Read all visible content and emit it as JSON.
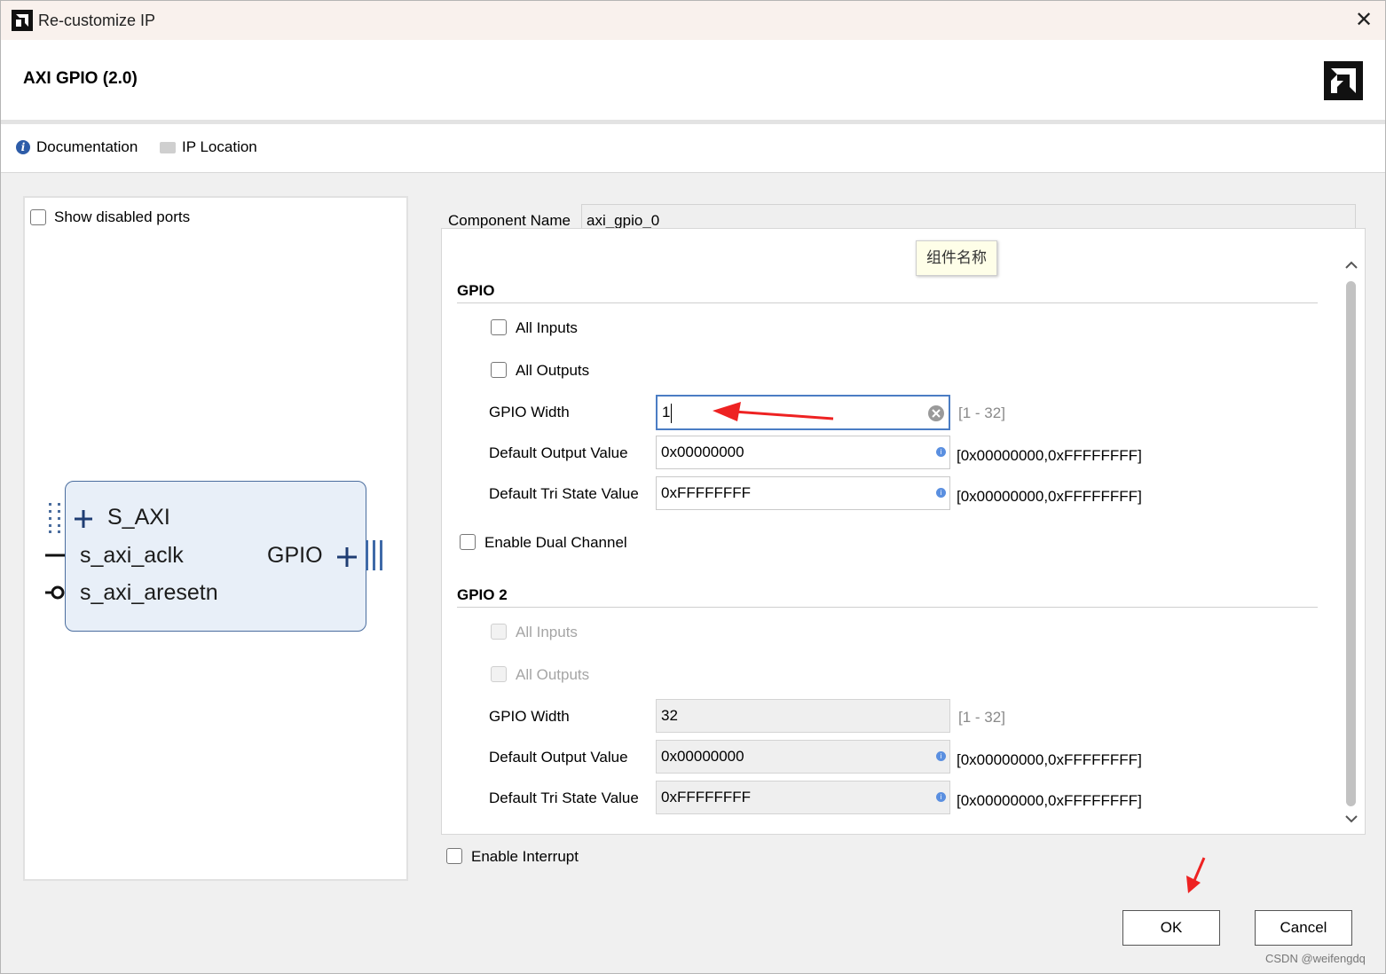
{
  "window": {
    "title": "Re-customize IP",
    "ip_name": "AXI GPIO (2.0)"
  },
  "toolbar": {
    "documentation": "Documentation",
    "ip_location": "IP Location"
  },
  "left_panel": {
    "show_disabled_ports": "Show disabled ports",
    "block": {
      "port_s_axi": "S_AXI",
      "port_aclk": "s_axi_aclk",
      "port_aresetn": "s_axi_aresetn",
      "port_gpio": "GPIO"
    }
  },
  "component": {
    "label": "Component Name",
    "value": "axi_gpio_0",
    "tooltip": "组件名称"
  },
  "gpio": {
    "title": "GPIO",
    "all_inputs": "All Inputs",
    "all_outputs": "All Outputs",
    "width_label": "GPIO Width",
    "width_value": "1",
    "width_range": "[1 - 32]",
    "dout_label": "Default Output Value",
    "dout_value": "0x00000000",
    "dout_range": "[0x00000000,0xFFFFFFFF]",
    "tri_label": "Default Tri State Value",
    "tri_value": "0xFFFFFFFF",
    "tri_range": "[0x00000000,0xFFFFFFFF]"
  },
  "dual_channel": "Enable Dual Channel",
  "gpio2": {
    "title": "GPIO 2",
    "all_inputs": "All Inputs",
    "all_outputs": "All Outputs",
    "width_label": "GPIO Width",
    "width_value": "32",
    "width_range": "[1 - 32]",
    "dout_label": "Default Output Value",
    "dout_value": "0x00000000",
    "dout_range": "[0x00000000,0xFFFFFFFF]",
    "tri_label": "Default Tri State Value",
    "tri_value": "0xFFFFFFFF",
    "tri_range": "[0x00000000,0xFFFFFFFF]"
  },
  "enable_interrupt": "Enable Interrupt",
  "buttons": {
    "ok": "OK",
    "cancel": "Cancel"
  },
  "watermark": "CSDN @weifengdq",
  "colors": {
    "annotation_arrow": "#ee2222",
    "block_fill": "#e8eff8",
    "block_stroke": "#4a6d9e",
    "active_border": "#4b7dc4"
  },
  "icons": [
    "app-logo-icon",
    "close-icon",
    "amd-logo-icon",
    "info-icon",
    "folder-icon",
    "clear-icon"
  ]
}
